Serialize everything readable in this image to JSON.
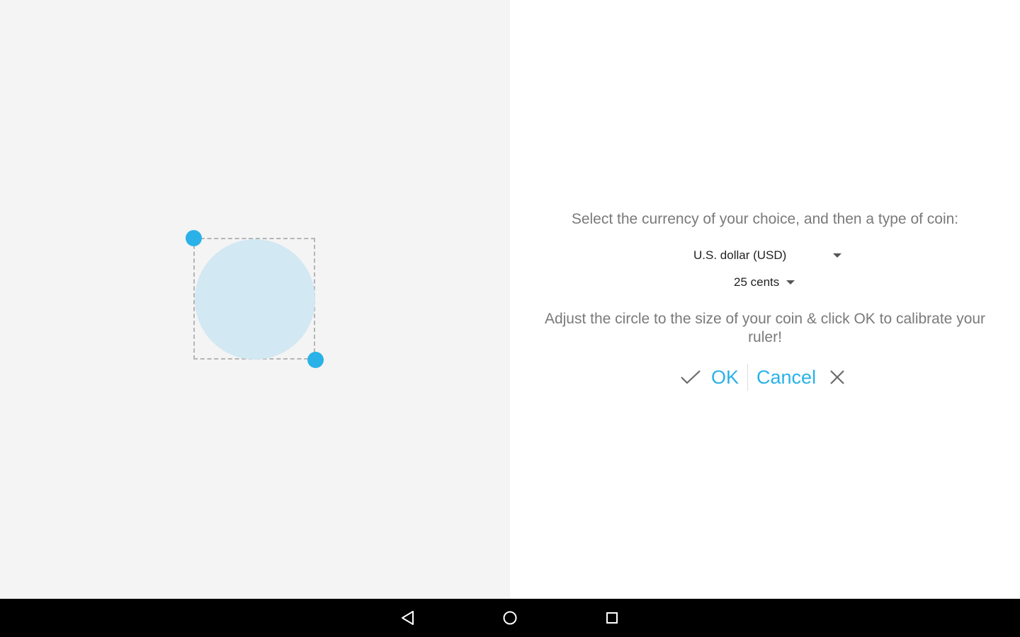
{
  "calibration": {
    "instruction_select": "Select the currency of your choice, and then a type of coin:",
    "currency_selected": "U.S. dollar (USD)",
    "coin_selected": "25 cents",
    "instruction_adjust": "Adjust the circle to the size of your coin & click OK to calibrate your ruler!",
    "ok_label": "OK",
    "cancel_label": "Cancel"
  },
  "icons": {
    "ok": "check-icon",
    "cancel": "close-icon",
    "dropdown": "caret-down-icon",
    "nav_back": "back-triangle-icon",
    "nav_home": "home-circle-icon",
    "nav_recents": "recents-square-icon"
  },
  "colors": {
    "accent": "#2ab2e8",
    "coin_fill": "#d2e8f2",
    "left_background": "#f4f4f4",
    "right_background": "#ffffff",
    "instruction_text": "#7a7a7a",
    "navbar": "#000000"
  }
}
